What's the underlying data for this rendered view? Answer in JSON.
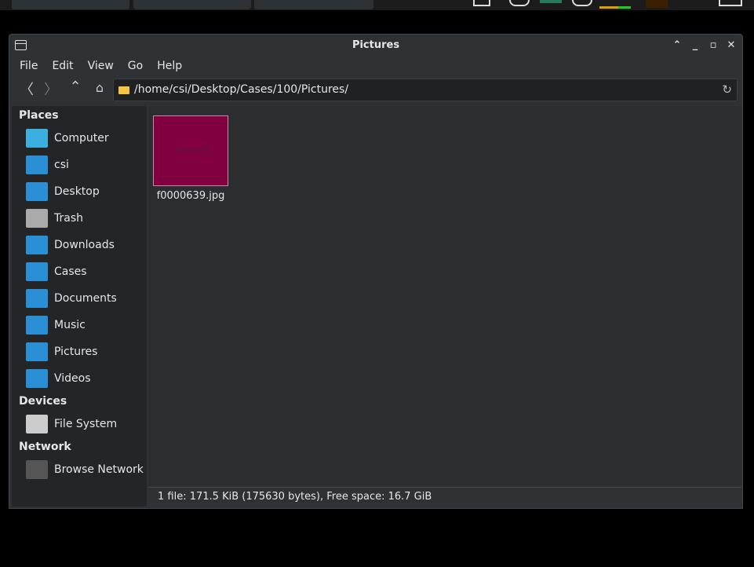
{
  "window": {
    "title": "Pictures"
  },
  "menu": [
    "File",
    "Edit",
    "View",
    "Go",
    "Help"
  ],
  "location": {
    "path": "/home/csi/Desktop/Cases/100/Pictures/"
  },
  "sidebar": {
    "places_label": "Places",
    "places": [
      {
        "label": "Computer",
        "icon": "computer-icon",
        "color": "#3bb0e0"
      },
      {
        "label": "csi",
        "icon": "home-folder-icon",
        "color": "#2b8fd6"
      },
      {
        "label": "Desktop",
        "icon": "desktop-folder-icon",
        "color": "#2b8fd6"
      },
      {
        "label": "Trash",
        "icon": "trash-icon",
        "color": "#aaaaaa"
      },
      {
        "label": "Downloads",
        "icon": "downloads-folder-icon",
        "color": "#2b8fd6"
      },
      {
        "label": "Cases",
        "icon": "cases-folder-icon",
        "color": "#2b8fd6"
      },
      {
        "label": "Documents",
        "icon": "documents-folder-icon",
        "color": "#2b8fd6"
      },
      {
        "label": "Music",
        "icon": "music-folder-icon",
        "color": "#2b8fd6"
      },
      {
        "label": "Pictures",
        "icon": "pictures-folder-icon",
        "color": "#2b8fd6"
      },
      {
        "label": "Videos",
        "icon": "videos-folder-icon",
        "color": "#2b8fd6"
      }
    ],
    "devices_label": "Devices",
    "devices": [
      {
        "label": "File System",
        "icon": "drive-icon",
        "color": "#cccccc"
      }
    ],
    "network_label": "Network",
    "network": [
      {
        "label": "Browse Network",
        "icon": "network-icon",
        "color": "#555555"
      }
    ]
  },
  "files": [
    {
      "name": "f0000639.jpg",
      "thumb_text": "I Am Picture #3",
      "thumb_color": "#800040"
    }
  ],
  "status": "1 file: 171.5 KiB (175630 bytes), Free space: 16.7 GiB"
}
